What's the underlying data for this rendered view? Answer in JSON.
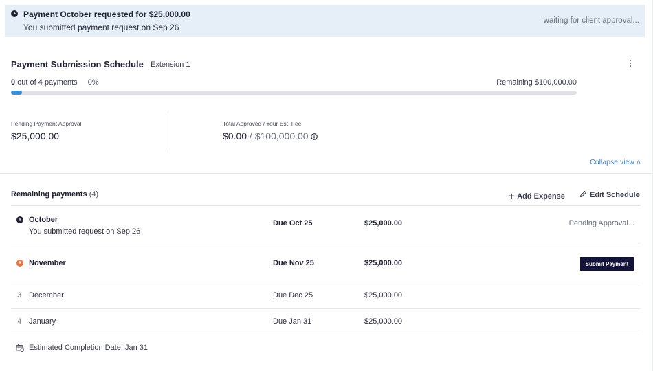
{
  "banner": {
    "title": "Payment October requested for $25,000.00",
    "subtitle": "You submitted payment request on Sep 26",
    "status": "waiting for client approval..."
  },
  "schedule": {
    "title": "Payment Submission Schedule",
    "extension": "Extension 1",
    "progress_count": "0",
    "progress_suffix": "out of 4 payments",
    "progress_pct": "0%",
    "progress_fraction": 0.02,
    "remaining": "Remaining $100,000.00",
    "pending_label": "Pending Payment Approval",
    "pending_value": "$25,000.00",
    "total_label": "Total Approved / Your Est. Fee",
    "total_approved": "$0.00",
    "total_sep": " / ",
    "total_fee": "$100,000.00",
    "collapse": "Collapse view ˄"
  },
  "remaining_payments": {
    "label": "Remaining payments",
    "count": "(4)",
    "add_expense": "Add Expense",
    "edit_schedule": "Edit Schedule",
    "rows": [
      {
        "name": "October",
        "sub": "You submitted request on Sep 26",
        "due": "Due Oct 25",
        "amount": "$25,000.00",
        "status": "Pending Approval..."
      },
      {
        "name": "November",
        "due": "Due Nov 25",
        "amount": "$25,000.00",
        "action": "Submit Payment"
      },
      {
        "num": "3",
        "name": "December",
        "due": "Due Dec 25",
        "amount": "$25,000.00"
      },
      {
        "num": "4",
        "name": "January",
        "due": "Due Jan 31",
        "amount": "$25,000.00"
      }
    ],
    "estimated": "Estimated Completion Date: Jan 31"
  },
  "colors": {
    "accent": "#3a8fd6",
    "banner_bg": "#e6eef7",
    "button_bg": "#14143a",
    "warning": "#e8794a"
  },
  "icons": {
    "banner": "clock-icon",
    "row1": "clock-icon",
    "row2": "clock-warning-icon",
    "menu": "kebab-icon",
    "info": "info-icon",
    "add": "plus-icon",
    "edit": "pencil-icon",
    "estimate": "calendar-icon"
  }
}
